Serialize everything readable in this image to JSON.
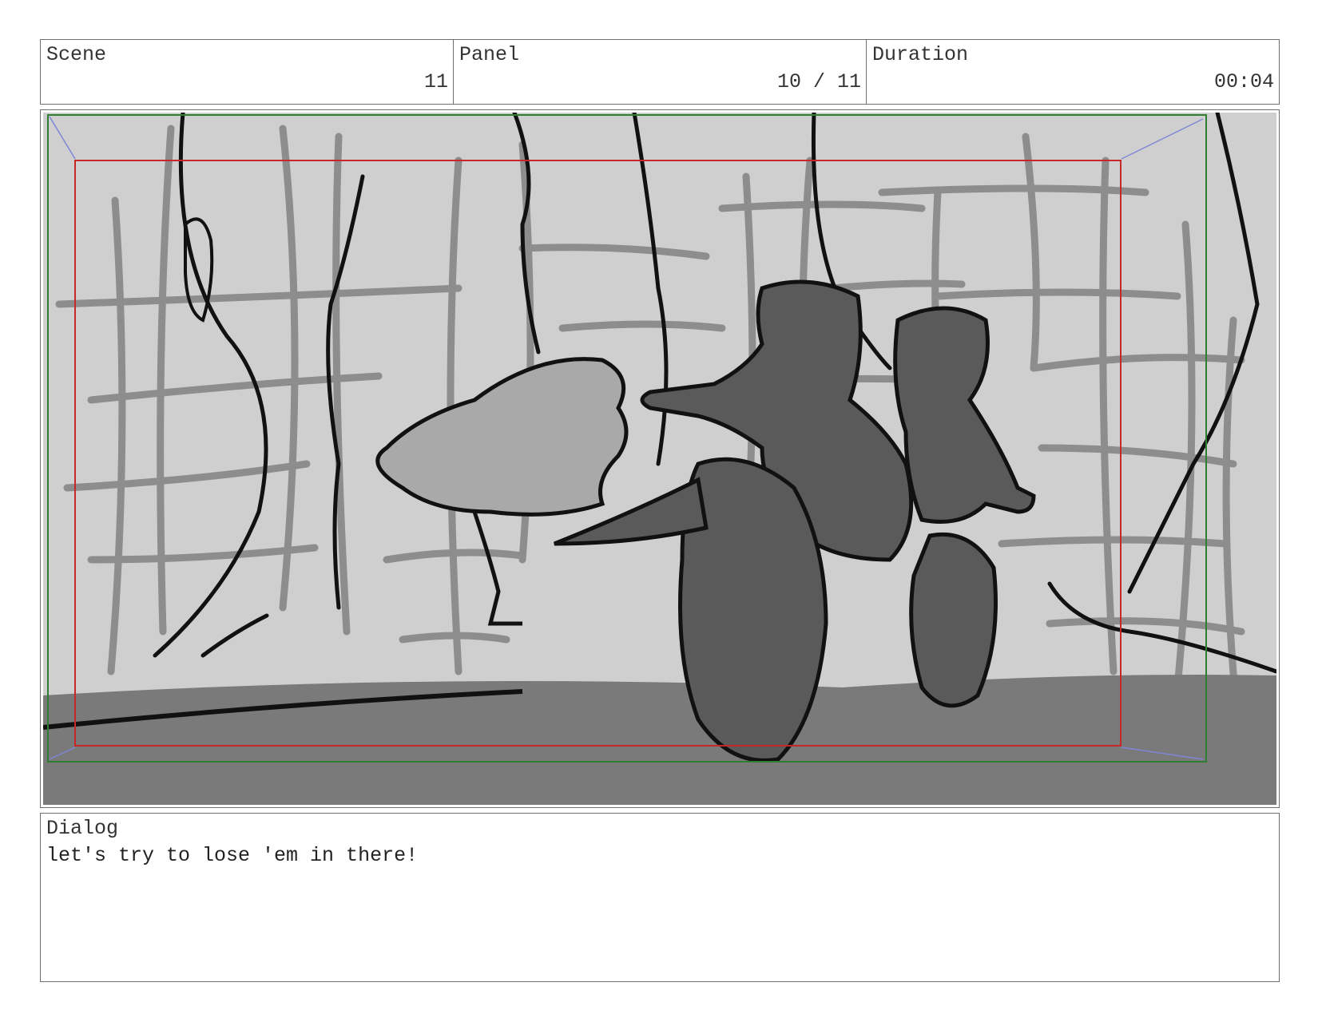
{
  "header": {
    "scene": {
      "label": "Scene",
      "value": "11"
    },
    "panel": {
      "label": "Panel",
      "value": "10 / 11"
    },
    "duration": {
      "label": "Duration",
      "value": "00:04"
    }
  },
  "dialog": {
    "label": "Dialog",
    "text": "let's try to lose 'em in there!"
  },
  "colors": {
    "safe_frame_outer": "#2e7d32",
    "safe_frame_inner": "#c62828",
    "corner_guides": "#7f86d6",
    "sketch_background": "#cfcfcf",
    "sketch_ground": "#7a7a7a",
    "sketch_figures": "#5a5a5a",
    "sketch_ink": "#111111"
  }
}
